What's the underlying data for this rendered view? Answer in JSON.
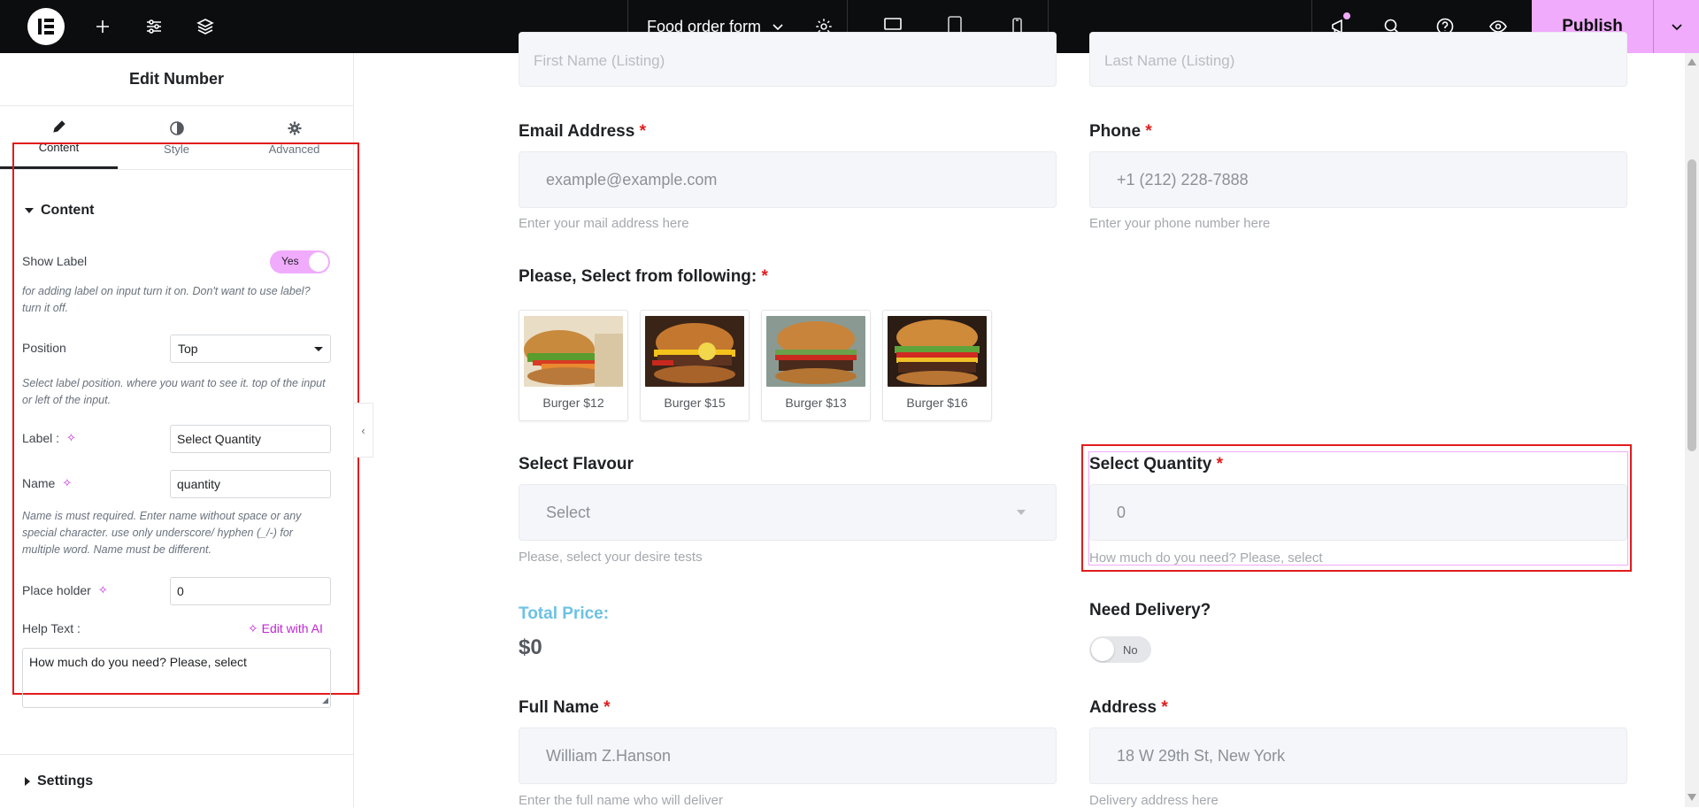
{
  "topbar": {
    "document_title": "Food order form",
    "publish_label": "Publish",
    "icons": [
      "elementor-logo-icon",
      "add-icon",
      "sliders-icon",
      "layers-icon",
      "chevron-down-icon",
      "gear-icon",
      "desktop-icon",
      "tablet-icon",
      "mobile-icon",
      "megaphone-icon",
      "search-icon",
      "help-icon",
      "eye-icon",
      "chevron-down-icon"
    ],
    "active_device": "desktop"
  },
  "panel": {
    "title": "Edit Number",
    "tabs": [
      {
        "label": "Content",
        "icon": "pencil-icon",
        "active": true
      },
      {
        "label": "Style",
        "icon": "half-circle-icon",
        "active": false
      },
      {
        "label": "Advanced",
        "icon": "gear-icon",
        "active": false
      }
    ],
    "section_content": "Content",
    "show_label": {
      "label": "Show Label",
      "value": "Yes",
      "help": "for adding label on input turn it on. Don't want to use label? turn it off."
    },
    "position": {
      "label": "Position",
      "value": "Top",
      "help": "Select label position. where you want to see it. top of the input or left of the input."
    },
    "label_field": {
      "label": "Label :",
      "value": "Select Quantity"
    },
    "name_field": {
      "label": "Name",
      "value": "quantity",
      "help": "Name is must required. Enter name without space or any special character. use only underscore/ hyphen (_/-) for multiple word. Name must be different."
    },
    "placeholder_field": {
      "label": "Place holder",
      "value": "0"
    },
    "help_text": {
      "label": "Help Text :",
      "edit_ai": "Edit with AI",
      "value": "How much do you need? Please, select"
    },
    "section_settings": "Settings"
  },
  "form": {
    "first_name_placeholder": "First Name (Listing)",
    "last_name_placeholder": "Last Name (Listing)",
    "email": {
      "label": "Email Address",
      "placeholder": "example@example.com",
      "help": "Enter your mail address here"
    },
    "phone": {
      "label": "Phone",
      "placeholder": "+1 (212) 228-7888",
      "help": "Enter your phone number here"
    },
    "select_following": {
      "label": "Please, Select from following:"
    },
    "burgers": [
      {
        "caption": "Burger $12"
      },
      {
        "caption": "Burger $15"
      },
      {
        "caption": "Burger $13"
      },
      {
        "caption": "Burger $16"
      }
    ],
    "flavour": {
      "label": "Select Flavour",
      "value": "Select",
      "help": "Please, select your desire tests"
    },
    "quantity": {
      "label": "Select Quantity",
      "placeholder": "0",
      "help": "How much do you need? Please, select"
    },
    "total_price": {
      "label": "Total Price:",
      "value": "$0"
    },
    "delivery": {
      "label": "Need Delivery?",
      "value": "No"
    },
    "full_name": {
      "label": "Full Name",
      "placeholder": "William Z.Hanson",
      "help": "Enter the full name who will deliver"
    },
    "address": {
      "label": "Address",
      "placeholder": "18 W 29th St, New York",
      "help": "Delivery address here"
    },
    "required_mark": "*"
  },
  "colors": {
    "accent": "#f0abfc",
    "highlight": "#e21c1c",
    "total_label": "#6ec1e4",
    "topbar": "#0c0d0e"
  }
}
